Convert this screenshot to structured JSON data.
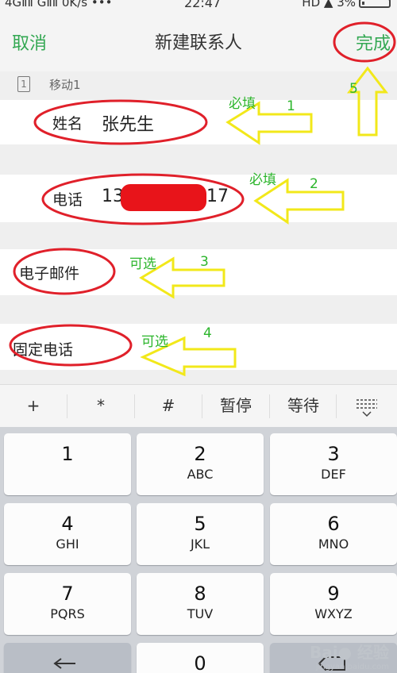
{
  "statusbar": {
    "left": "4GⅡⅡ GⅡⅡ 0K/s •••",
    "time": "22:47",
    "right": "HD ▲ 3%"
  },
  "header": {
    "cancel_label": "取消",
    "title": "新建联系人",
    "done_label": "完成"
  },
  "account": {
    "sim_number": "1",
    "label": "移动1"
  },
  "form": {
    "name_label": "姓名",
    "name_value": "张先生",
    "phone_label": "电话",
    "phone_prefix": "13",
    "phone_suffix": "17",
    "email_label": "电子邮件",
    "landline_label": "固定电话"
  },
  "annotations": {
    "required_1": "必填",
    "required_2": "必填",
    "optional_3": "可选",
    "optional_4": "可选",
    "n1": "1",
    "n2": "2",
    "n3": "3",
    "n4": "4",
    "n5": "5",
    "color_circle": "#e0202a",
    "color_arrow": "#f2e81a",
    "color_text": "#2bb52b"
  },
  "symbols": [
    "+",
    "*",
    "#",
    "暂停",
    "等待"
  ],
  "keypad": [
    {
      "digit": "1",
      "letters": ""
    },
    {
      "digit": "2",
      "letters": "ABC"
    },
    {
      "digit": "3",
      "letters": "DEF"
    },
    {
      "digit": "4",
      "letters": "GHI"
    },
    {
      "digit": "5",
      "letters": "JKL"
    },
    {
      "digit": "6",
      "letters": "MNO"
    },
    {
      "digit": "7",
      "letters": "PQRS"
    },
    {
      "digit": "8",
      "letters": "TUV"
    },
    {
      "digit": "9",
      "letters": "WXYZ"
    },
    {
      "digit": "0",
      "letters": ""
    }
  ],
  "watermark": {
    "main": "Bai● 经验",
    "sub": "jingyan.baidu.com"
  },
  "colors": {
    "accent_green": "#34a853"
  }
}
